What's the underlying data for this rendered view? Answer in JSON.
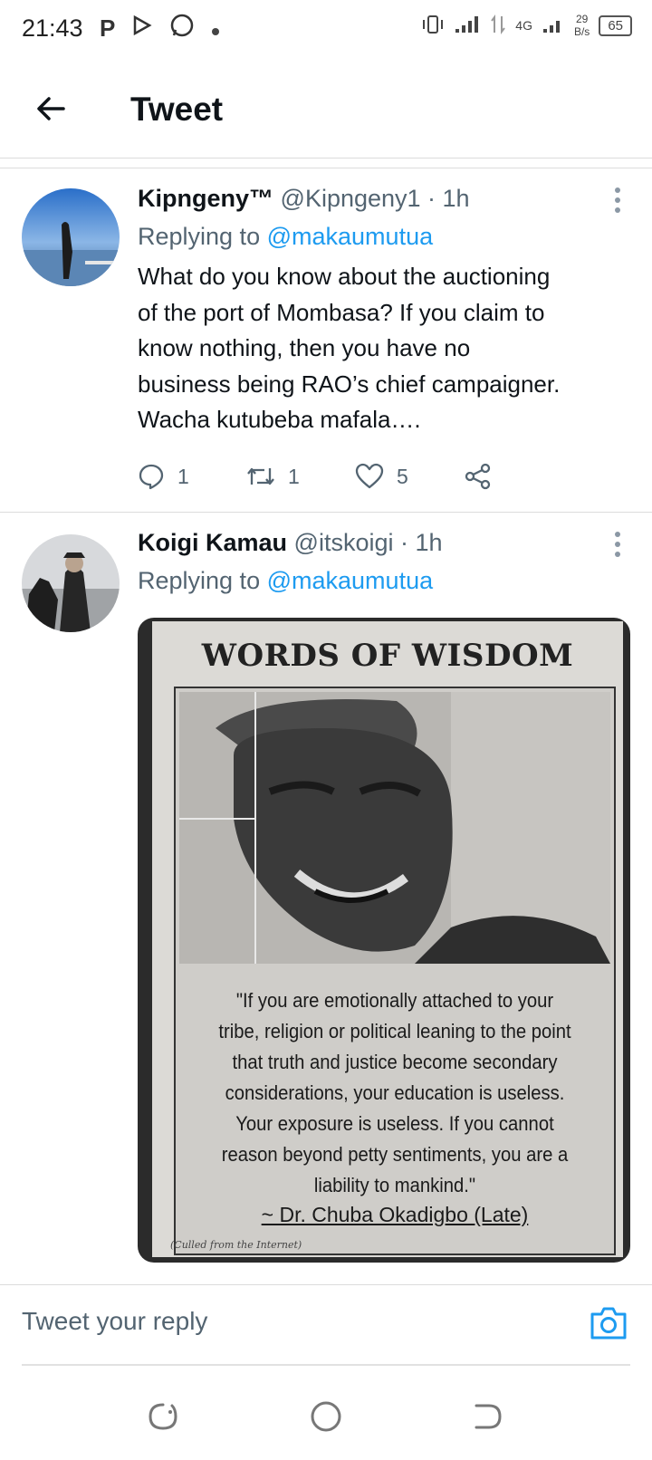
{
  "status_bar": {
    "time": "21:43",
    "left_icons": [
      "p-icon",
      "play-store-icon",
      "whatsapp-icon",
      "dot-icon"
    ],
    "network": "4G",
    "speed_value": "29",
    "speed_unit": "B/s",
    "battery": "65"
  },
  "header": {
    "title": "Tweet"
  },
  "tweets": [
    {
      "name": "Kipngeny™",
      "handle": "@Kipngeny1 · 1h",
      "replying_prefix": "Replying to",
      "replying_to": "@makaumutua",
      "lines": [
        "What do you know about the auctioning",
        "of the port of Mombasa? If you claim to",
        "know nothing, then you have no",
        "business being RAO’s chief campaigner.",
        "Wacha kutubeba mafala…."
      ],
      "replies": "1",
      "retweets": "1",
      "likes": "5"
    },
    {
      "name": "Koigi Kamau",
      "handle": "@itskoigi · 1h",
      "replying_prefix": "Replying to",
      "replying_to": "@makaumutua",
      "image": {
        "headline": "WORDS OF WISDOM",
        "quote_lines": [
          "\"If you are emotionally attached to your",
          "tribe, religion or political leaning to the point",
          "that truth and justice become secondary",
          "considerations, your education is useless.",
          "Your exposure is useless. If you cannot",
          "reason beyond petty sentiments, you are a",
          "liability to mankind.\""
        ],
        "attribution": "~ Dr. Chuba Okadigbo (Late)",
        "credit": "(Culled from the Internet)"
      }
    }
  ],
  "reply_bar": {
    "placeholder": "Tweet your reply"
  }
}
